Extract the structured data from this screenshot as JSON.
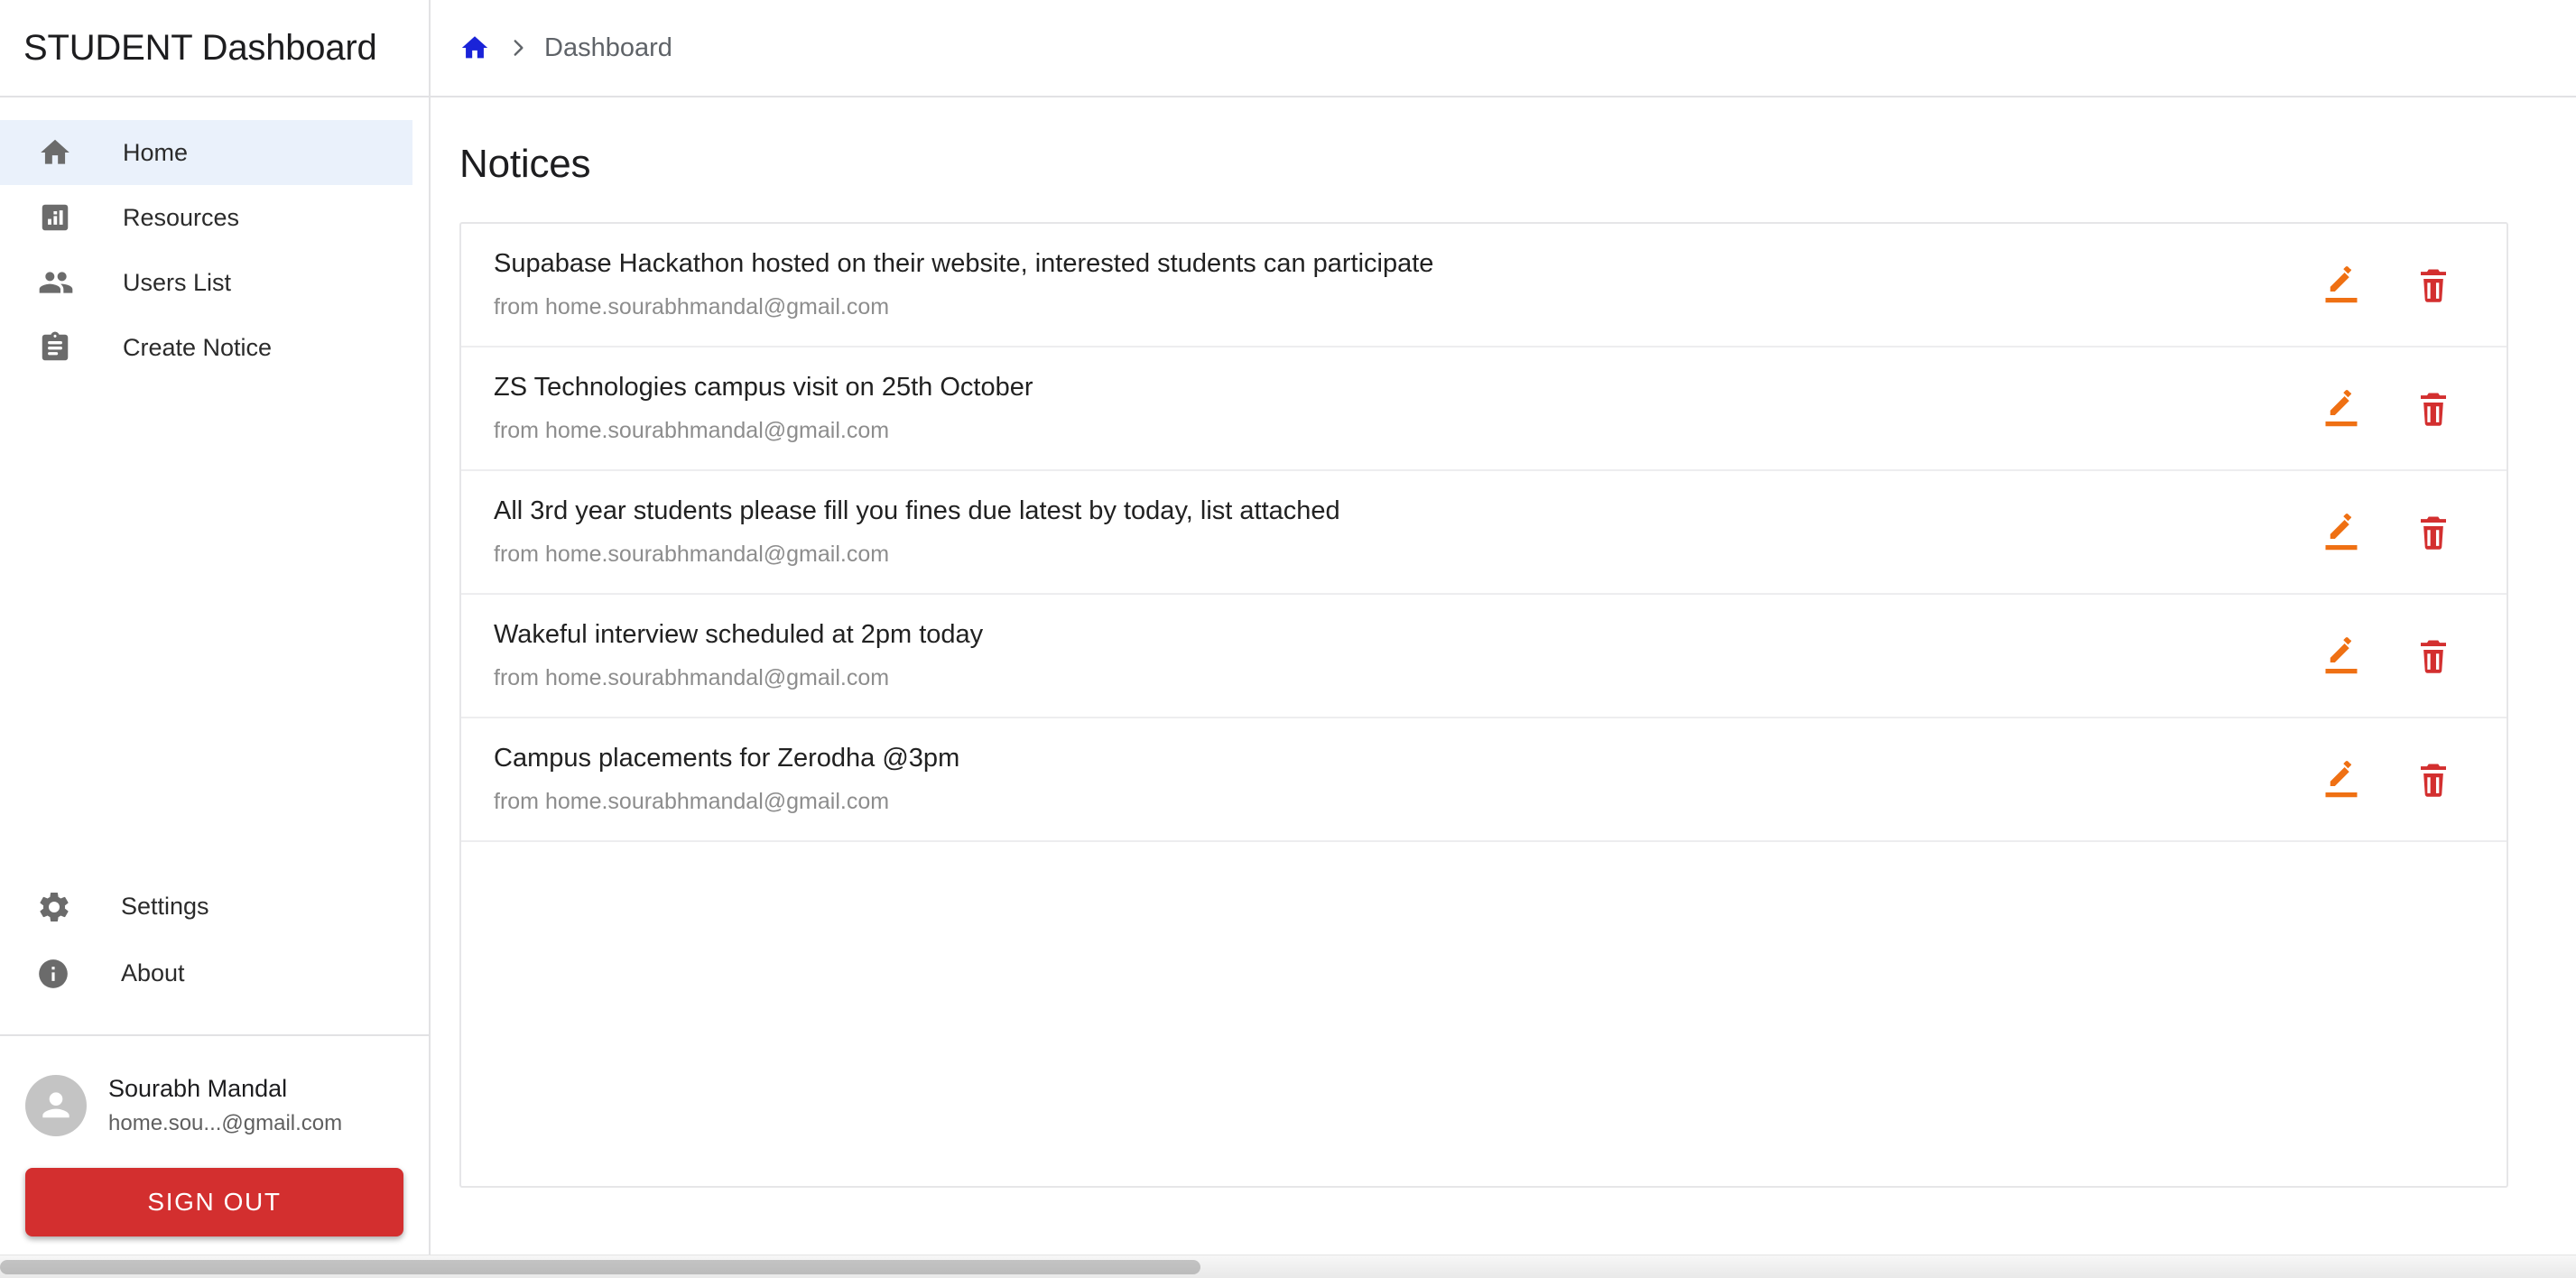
{
  "sidebar": {
    "brand_title": "STUDENT Dashboard",
    "nav_items": [
      {
        "label": "Home",
        "icon": "home-icon",
        "active": true
      },
      {
        "label": "Resources",
        "icon": "bar-chart-icon",
        "active": false
      },
      {
        "label": "Users List",
        "icon": "people-icon",
        "active": false
      },
      {
        "label": "Create Notice",
        "icon": "clipboard-icon",
        "active": false
      }
    ],
    "secondary_items": [
      {
        "label": "Settings",
        "icon": "gear-icon"
      },
      {
        "label": "About",
        "icon": "info-icon"
      }
    ],
    "user": {
      "name": "Sourabh Mandal",
      "email": "home.sou...@gmail.com",
      "avatar_icon": "person-avatar-icon"
    },
    "signout_label": "SIGN OUT"
  },
  "topbar": {
    "breadcrumb": {
      "home_icon": "home-icon",
      "separator_icon": "chevron-right-icon",
      "current": "Dashboard"
    }
  },
  "main": {
    "page_title": "Notices",
    "notices": [
      {
        "title": "Supabase Hackathon hosted on their website, interested students can participate",
        "subtitle": "from home.sourabhmandal@gmail.com",
        "edit_icon": "edit-pencil-icon",
        "delete_icon": "trash-icon"
      },
      {
        "title": "ZS Technologies campus visit on 25th October",
        "subtitle": "from home.sourabhmandal@gmail.com",
        "edit_icon": "edit-pencil-icon",
        "delete_icon": "trash-icon"
      },
      {
        "title": "All 3rd year students please fill you fines due latest by today, list attached",
        "subtitle": "from home.sourabhmandal@gmail.com",
        "edit_icon": "edit-pencil-icon",
        "delete_icon": "trash-icon"
      },
      {
        "title": "Wakeful interview scheduled at 2pm today",
        "subtitle": "from home.sourabhmandal@gmail.com",
        "edit_icon": "edit-pencil-icon",
        "delete_icon": "trash-icon"
      },
      {
        "title": "Campus placements for Zerodha @3pm",
        "subtitle": "from home.sourabhmandal@gmail.com",
        "edit_icon": "edit-pencil-icon",
        "delete_icon": "trash-icon"
      }
    ]
  },
  "colors": {
    "accent_blue": "#1a23d8",
    "active_nav_bg": "#eaf1fb",
    "signout_red": "#d32f2f",
    "edit_orange": "#ef7013",
    "delete_red": "#d32f2f",
    "icon_gray": "#6b6b6b",
    "muted_text": "#8d8d8d",
    "border": "#e2e2e4"
  }
}
